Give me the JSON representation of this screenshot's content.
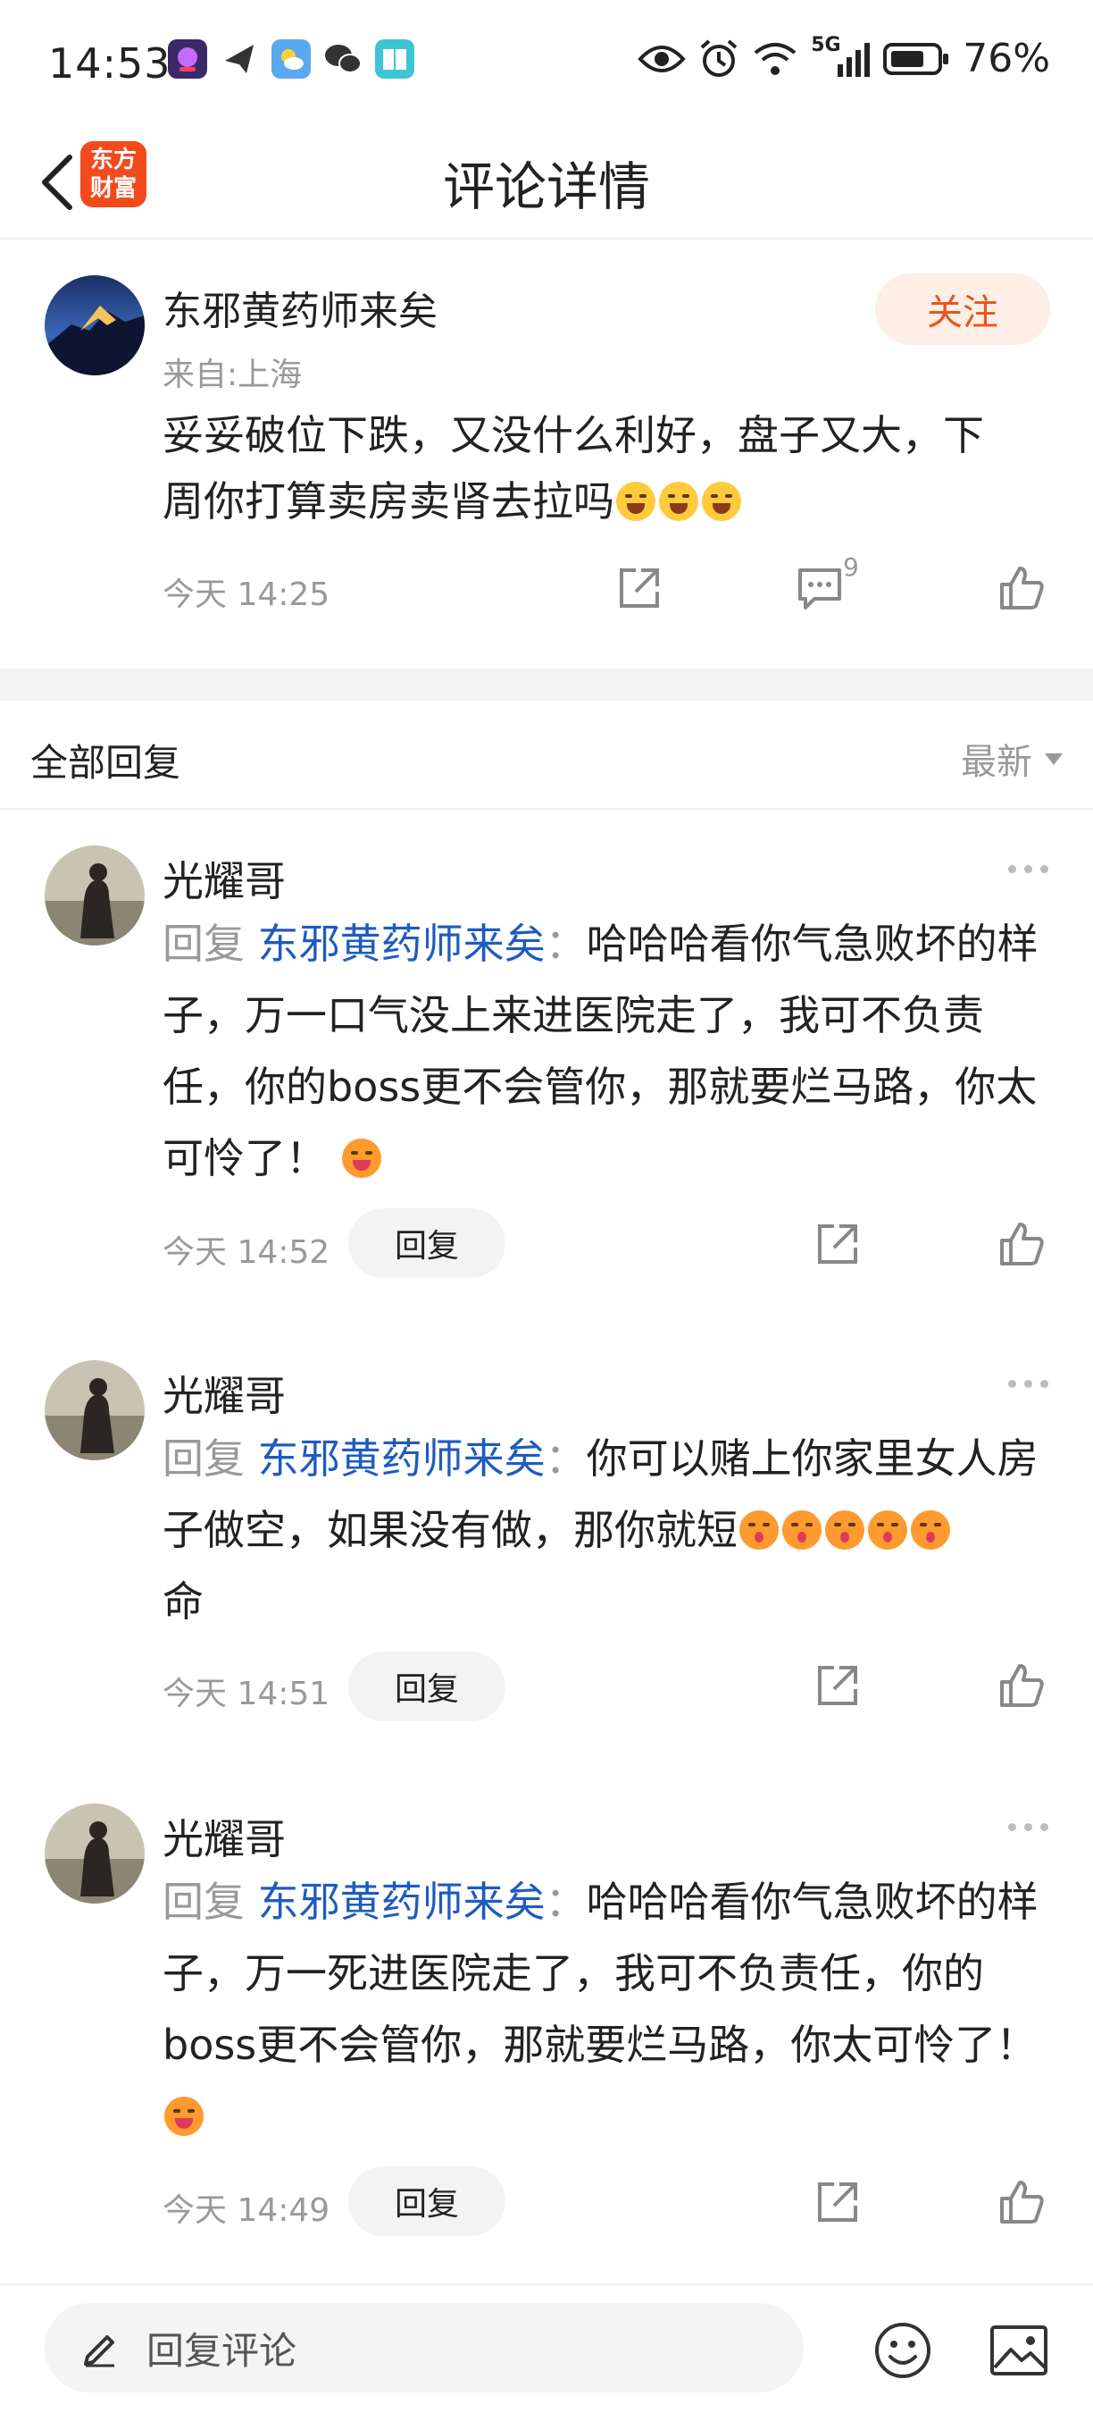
{
  "status_bar": {
    "time": "14:53",
    "network": "5G",
    "battery": "76%",
    "icons": [
      "app-notification-icon",
      "paper-plane-icon",
      "weather-icon",
      "wechat-icon",
      "book-icon",
      "eye-icon",
      "alarm-icon",
      "wifi-icon",
      "signal-icon",
      "battery-icon"
    ]
  },
  "header": {
    "title": "评论详情",
    "logo_line1": "东方",
    "logo_line2": "财富"
  },
  "post": {
    "author": "东邪黄药师来矣",
    "location": "来自:上海",
    "follow_label": "关注",
    "text_line1": "妥妥破位下跌，又没什么利好，盘子又大，下",
    "text_line2": "周你打算卖房卖肾去拉吗",
    "time": "今天 14:25",
    "comment_count": "9"
  },
  "replies_header": {
    "title": "全部回复",
    "sort_label": "最新"
  },
  "replies": [
    {
      "author": "光耀哥",
      "prefix": "回复 ",
      "target": "东邪黄药师来矣",
      "colon": "：",
      "text": "哈哈哈看你气急败坏的样子，万一口气没上来进医院走了，我可不负责任，你的boss更不会管你，那就要烂马路，你太可怜了！",
      "time": "今天 14:52",
      "reply_label": "回复"
    },
    {
      "author": "光耀哥",
      "prefix": "回复 ",
      "target": "东邪黄药师来矣",
      "colon": "：",
      "text": "你可以赌上你家里女人房子做空，如果没有做，那你就短",
      "text_tail": "命",
      "time": "今天 14:51",
      "reply_label": "回复"
    },
    {
      "author": "光耀哥",
      "prefix": "回复 ",
      "target": "东邪黄药师来矣",
      "colon": "：",
      "text": "哈哈哈看你气急败坏的样子，万一死进医院走了，我可不负责任，你的boss更不会管你，那就要烂马路，你太可怜了！",
      "time": "今天 14:49",
      "reply_label": "回复"
    }
  ],
  "bottom_bar": {
    "input_placeholder": "回复评论"
  },
  "colors": {
    "accent": "#e8541e",
    "link": "#1e5bbf",
    "muted": "#999999"
  }
}
